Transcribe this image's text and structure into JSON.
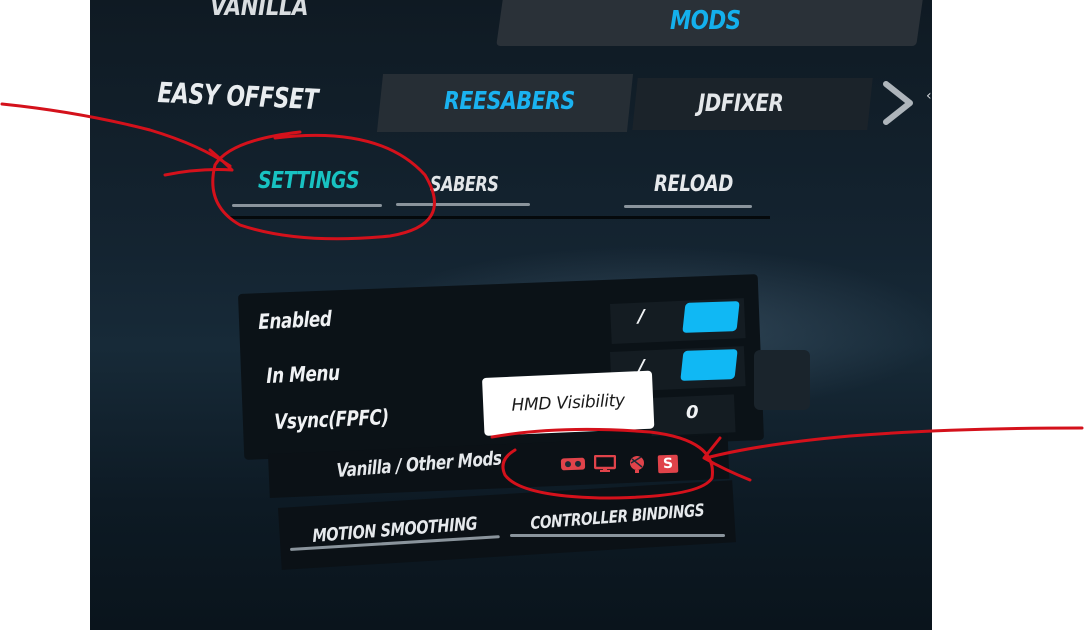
{
  "top_tabs": {
    "left_label": "VANILLA",
    "right_label": "MODS"
  },
  "mod_tabs": {
    "left_label": "EASY OFFSET",
    "tab1_label": "REESABERS",
    "tab2_label": "JDFIXER"
  },
  "sub_tabs": {
    "settings_label": "SETTINGS",
    "sabers_label": "SABERS",
    "reload_label": "RELOAD"
  },
  "settings": {
    "enabled_label": "Enabled",
    "in_menu_label": "In Menu",
    "vsync_label": "Vsync(FPFC)",
    "separator_1": "/",
    "separator_2": "/",
    "vsync_value": "0",
    "enabled_on": true,
    "in_menu_on": true
  },
  "tooltip": {
    "text": "HMD Visibility"
  },
  "visibility_row": {
    "label": "Vanilla / Other Mods"
  },
  "bottom_buttons": {
    "motion_smoothing_label": "MOTION SMOOTHING",
    "controller_bindings_label": "CONTROLLER BINDINGS"
  },
  "colors": {
    "accent_blue": "#10b8f4",
    "accent_teal": "#18c2c2",
    "annotation_red": "#d4111b",
    "icon_red": "#e0434a"
  },
  "icons": [
    "vr-headset-icon",
    "monitor-icon",
    "globe-icon",
    "streaming-s-icon"
  ]
}
